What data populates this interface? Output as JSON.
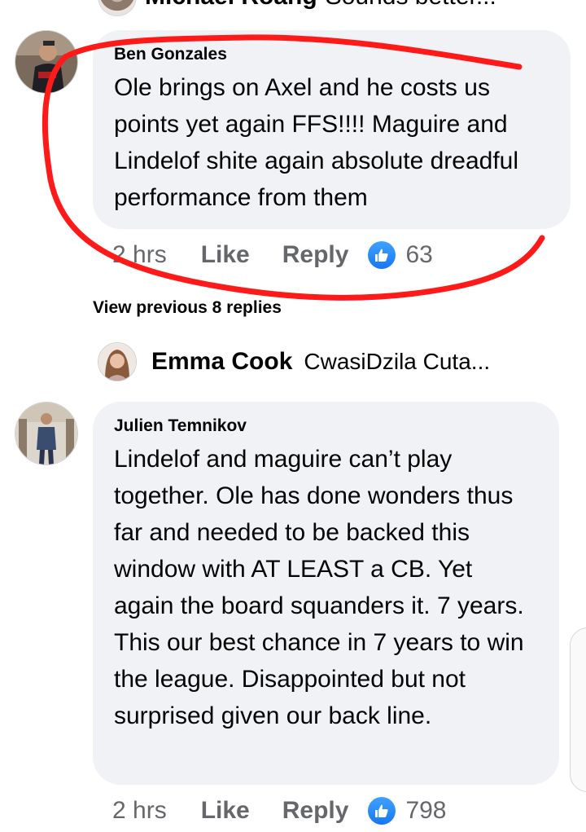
{
  "top_reply": {
    "name": "Michael Roang",
    "snippet": "Sounds better..."
  },
  "comments": [
    {
      "author": "Ben Gonzales",
      "text": "Ole brings on Axel and he costs us points yet again FFS!!!! Maguire and Lindelof shite again absolute dreadful performance from them",
      "time": "2 hrs",
      "like_label": "Like",
      "reply_label": "Reply",
      "reactions": "63"
    },
    {
      "author": "Julien Temnikov",
      "text": "Lindelof and maguire can’t play together. Ole has done wonders thus far and needed to be backed this window with AT LEAST a CB. Yet again the board squanders it. 7 years. This our best chance in 7 years to win the league. Disappointed but not surprised given our back line.",
      "time": "2 hrs",
      "like_label": "Like",
      "reply_label": "Reply",
      "reactions": "798"
    }
  ],
  "view_previous": "View previous 8 replies",
  "reply_preview": {
    "name": "Emma Cook",
    "snippet": "CwasiDzila Cuta..."
  },
  "icons": {
    "like_reaction": "thumbs-up-icon"
  },
  "colors": {
    "bubble_bg": "#f0f2f5",
    "secondary_text": "#65676b",
    "like_blue": "#1877f2",
    "annotation_red": "#ff1a1a"
  }
}
